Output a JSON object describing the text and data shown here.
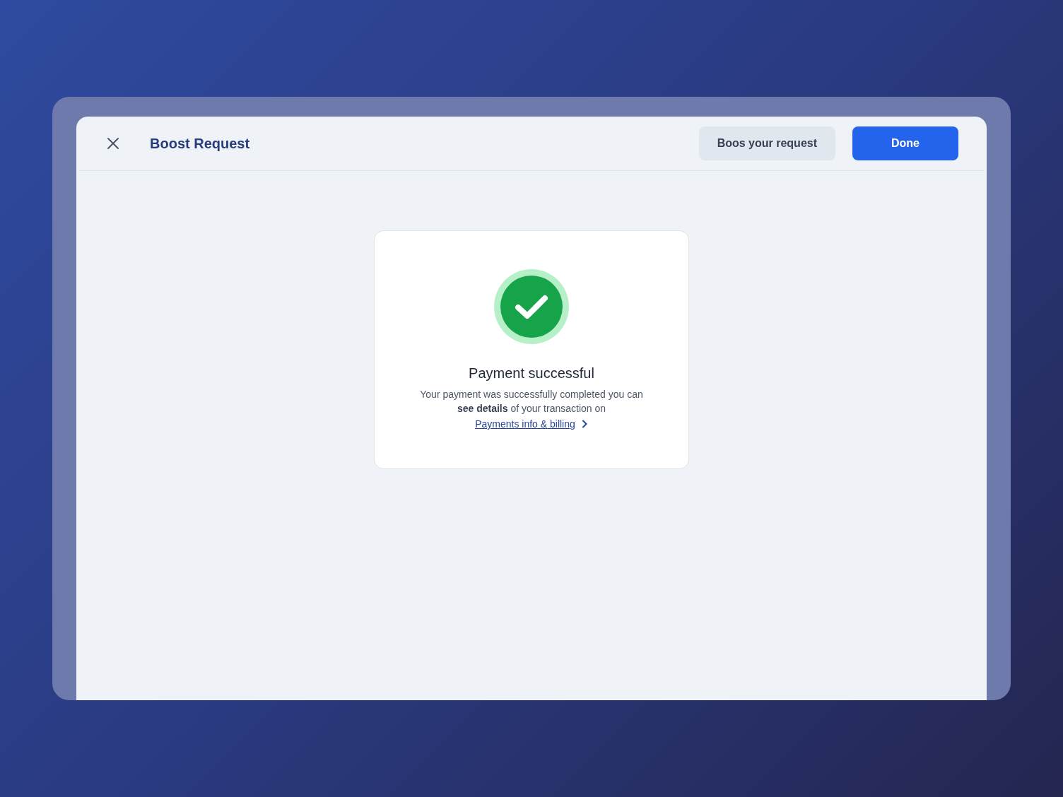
{
  "modal": {
    "title": "Boost Request",
    "buttons": [
      {
        "label": "Boos your request",
        "kind": "secondary"
      },
      {
        "label": "Done",
        "kind": "primary"
      }
    ]
  },
  "result": {
    "title": "Payment successful",
    "message": "Your payment was successfully completed you can **see details** of your transaction on",
    "link": "Payments info & billing"
  }
}
